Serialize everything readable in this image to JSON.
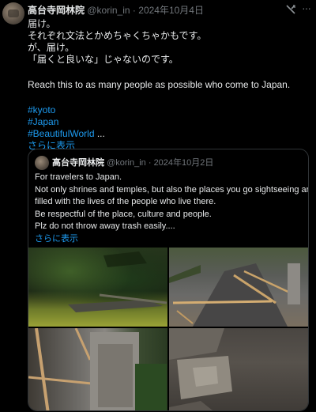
{
  "author": {
    "name": "高台寺岡林院",
    "handle": "@korin_in",
    "separator": "·",
    "date": "2024年10月4日"
  },
  "tweet": {
    "lines": [
      "届け。",
      "それぞれ文法とかめちゃくちゃかもです。",
      "が、届け。",
      "「届くと良いな」じゃないのです。"
    ],
    "english": "Reach this to as many people as possible who come to Japan.",
    "hashtags": [
      "#kyoto",
      "#Japan",
      "#BeautifulWorld"
    ],
    "ellipsis": " ...",
    "show_more": "さらに表示"
  },
  "quote": {
    "name": "高台寺岡林院",
    "handle": "@korin_in",
    "separator": "·",
    "date": "2024年10月2日",
    "lines": [
      "For travelers to Japan.",
      "Not only shrines and temples, but also the places you go sightseeing are",
      "filled with the lives of the people who live there.",
      "Be respectful of the place, culture and people.",
      "Plz do not throw away trash easily...."
    ],
    "show_more": "さらに表示"
  },
  "icons": {
    "avatar": "temple-avatar-icon",
    "grok": "grok-icon",
    "more": "more-options-icon"
  },
  "colors": {
    "link": "#1d9bf0",
    "secondary_text": "#71767b",
    "border": "#2f3336"
  }
}
